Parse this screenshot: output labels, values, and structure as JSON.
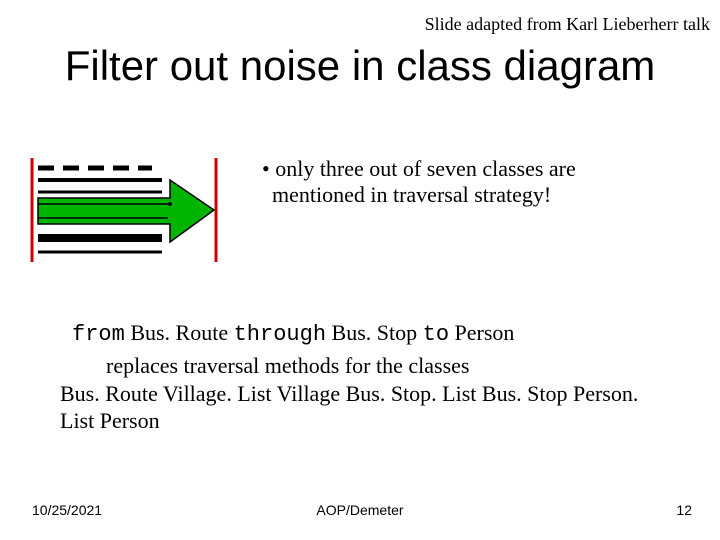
{
  "attribution": "Slide adapted from Karl Lieberherr talk",
  "title": "Filter out noise in class diagram",
  "bullet": "only three out of seven classes are mentioned in traversal strategy!",
  "traversal": {
    "kw_from": "from",
    "cls1": " Bus. Route ",
    "kw_through": "through",
    "cls2": " Bus. Stop ",
    "kw_to": "to",
    "cls3": " Person"
  },
  "explain_line1": "replaces traversal methods for the classes",
  "explain_line2": "Bus. Route Village. List Village Bus. Stop. List Bus. Stop Person. List Person",
  "footer": {
    "date": "10/25/2021",
    "center": "AOP/Demeter",
    "page": "12"
  }
}
